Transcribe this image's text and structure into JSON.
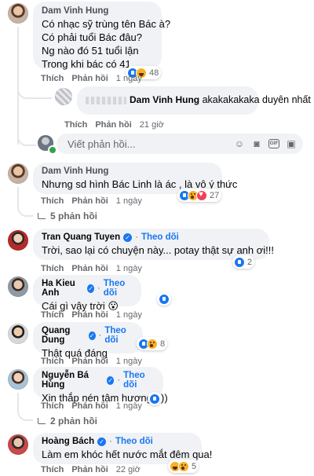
{
  "composer": {
    "placeholder": "Viết phản hồi..."
  },
  "labels": {
    "like": "Thích",
    "reply": "Phản hồi",
    "follow": "Theo dõi"
  },
  "comments": [
    {
      "author": "Dam Vinh Hung",
      "lines": [
        "Có nhạc sỹ trùng tên Bác à?",
        "Có phải tuổi Bác đâu?",
        "Ng nào đó 51 tuổi lận",
        "Trong khi bác có 41"
      ],
      "time": "1 ngày",
      "reaction_count": "48",
      "reactions": [
        "like",
        "haha"
      ]
    },
    {
      "author": "Dam Vinh Hung",
      "text": "akakakakaka duyên nhất",
      "time": "21 giờ",
      "nested": true
    },
    {
      "author": "Dam Vinh Hung",
      "text": "Nhưng sd hình Bác Linh là ác , là vô ý thức",
      "time": "1 ngày",
      "reaction_count": "27",
      "reactions": [
        "like",
        "sad",
        "love"
      ],
      "replies": "5 phản hồi"
    },
    {
      "author": "Tran Quang Tuyen",
      "verified": true,
      "text": "Trời, sao lại có chuyện này... potay thật sự anh ơi!!!",
      "time": "1 ngày",
      "reaction_count": "2",
      "reactions": [
        "like"
      ]
    },
    {
      "author": "Ha Kieu Anh",
      "verified": true,
      "text": "Cái gì vậy trời 😮",
      "time": "1 ngày",
      "reaction_count": "",
      "reactions": [
        "like"
      ]
    },
    {
      "author": "Quang Dung",
      "verified": true,
      "text": "Thật quá đáng",
      "time": "1 ngày",
      "reaction_count": "8",
      "reactions": [
        "like",
        "sad"
      ]
    },
    {
      "author": "Nguyễn Bá Hùng",
      "verified": true,
      "text": "Xin thắp nén tâm hương =))",
      "time": "1 ngày",
      "reaction_count": "",
      "reactions": [
        "like"
      ],
      "replies": "2 phản hồi"
    },
    {
      "author": "Hoàng Bách",
      "verified": true,
      "text": "Làm em khóc hết nước mắt đêm qua!",
      "time": "22 giờ",
      "reaction_count": "5",
      "reactions": [
        "haha",
        "sad"
      ]
    }
  ]
}
